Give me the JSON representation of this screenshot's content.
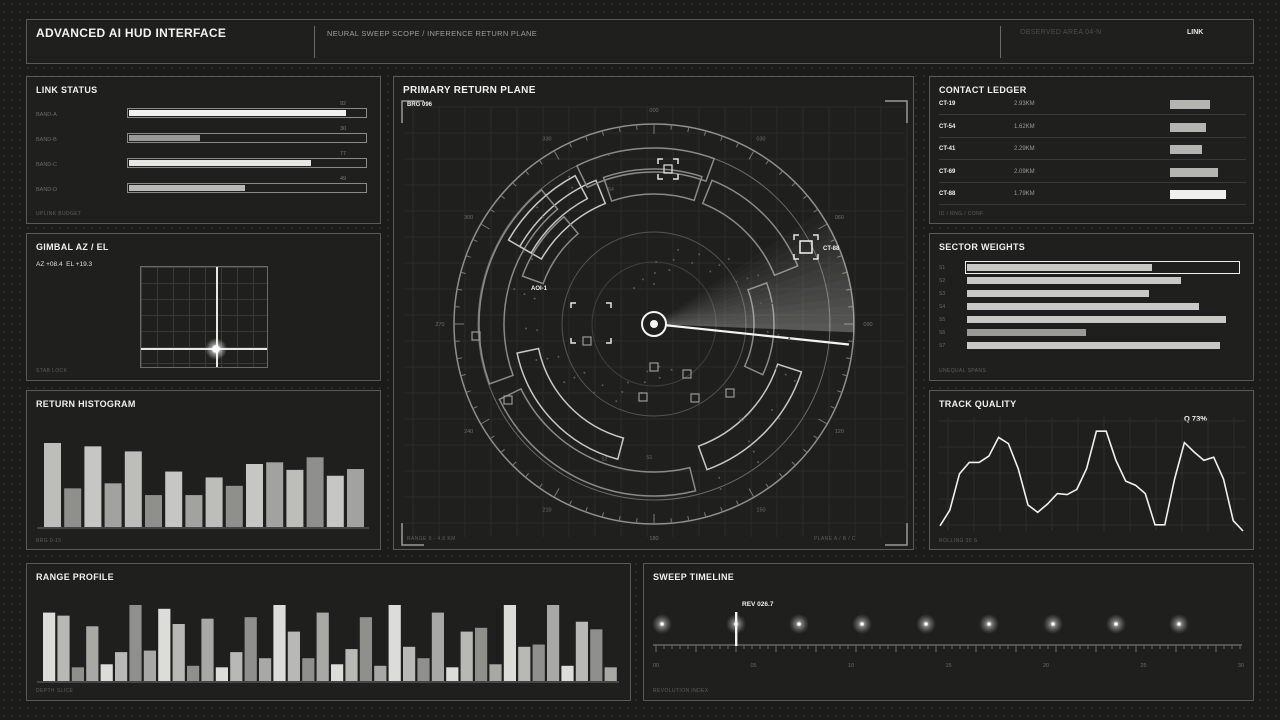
{
  "header": {
    "title": "ADVANCED AI HUD INTERFACE",
    "subtitle": "NEURAL SWEEP SCOPE / INFERENCE RETURN PLANE",
    "area": "OBSERVED AREA 04-N",
    "link": "LINK"
  },
  "link_status": {
    "title": "LINK STATUS",
    "footer": "UPLINK BUDGET",
    "bands": [
      {
        "label": "BAND-A",
        "value": "92",
        "level": 0.92
      },
      {
        "label": "BAND-B",
        "value": "30",
        "level": 0.3
      },
      {
        "label": "BAND-C",
        "value": "77",
        "level": 0.77
      },
      {
        "label": "BAND-D",
        "value": "49",
        "level": 0.49
      }
    ]
  },
  "gimbal": {
    "title": "GIMBAL AZ / EL",
    "readout": "AZ +08.4  EL +19.3",
    "footer": "STAB LOCK"
  },
  "histogram": {
    "title": "RETURN HISTOGRAM",
    "footer": "BRG 0-15"
  },
  "primary": {
    "title": "PRIMARY RETURN PLANE",
    "bearing": "BRG 096",
    "footer_left": "RANGE 0 - 4.8 KM",
    "footer_right": "PLANE A / B / C",
    "bearings": [
      {
        "label": "000"
      },
      {
        "label": "030"
      },
      {
        "label": "060"
      },
      {
        "label": "090"
      },
      {
        "label": "120"
      },
      {
        "label": "150"
      },
      {
        "label": "180"
      },
      {
        "label": "210"
      },
      {
        "label": "240"
      },
      {
        "label": "270"
      },
      {
        "label": "300"
      },
      {
        "label": "330"
      }
    ],
    "sectors": [
      "S4",
      "S2",
      "S1",
      "S7"
    ],
    "contacts": [
      "CT-88",
      "AOI-1"
    ]
  },
  "contacts": {
    "title": "CONTACT LEDGER",
    "footer": "ID / RNG / CONF",
    "rows": [
      {
        "id": "CT-19",
        "range": "2.93KM",
        "conf": 0.72
      },
      {
        "id": "CT-54",
        "range": "1.62KM",
        "conf": 0.65
      },
      {
        "id": "CT-41",
        "range": "2.29KM",
        "conf": 0.58
      },
      {
        "id": "CT-69",
        "range": "2.09KM",
        "conf": 0.86
      },
      {
        "id": "CT-88",
        "range": "1.79KM",
        "conf": 1.0
      }
    ]
  },
  "sectors": {
    "title": "SECTOR WEIGHTS",
    "footer": "UNEQUAL SPANS",
    "rows": [
      {
        "label": "S1",
        "weight": 0.7
      },
      {
        "label": "S2",
        "weight": 0.81
      },
      {
        "label": "S3",
        "weight": 0.69
      },
      {
        "label": "S4",
        "weight": 0.88
      },
      {
        "label": "S5",
        "weight": 0.98
      },
      {
        "label": "S6",
        "weight": 0.45
      },
      {
        "label": "S7",
        "weight": 0.96
      }
    ]
  },
  "track": {
    "title": "TRACK QUALITY",
    "quality": "Q 73%",
    "footer": "ROLLING 30 S"
  },
  "range_profile": {
    "title": "RANGE PROFILE",
    "footer": "DEPTH SLICE"
  },
  "sweep": {
    "title": "SWEEP TIMELINE",
    "marker": "REV 026.7",
    "footer": "REVOLUTION INDEX",
    "ticks": [
      "00",
      "05",
      "10",
      "15",
      "20",
      "25",
      "30"
    ]
  },
  "chart_data": [
    {
      "type": "bar",
      "title": "RETURN HISTOGRAM",
      "values": [
        100,
        46,
        96,
        52,
        90,
        38,
        66,
        38,
        59,
        49,
        75,
        77,
        68,
        83,
        61,
        69
      ],
      "ylim": [
        0,
        100
      ]
    },
    {
      "type": "line",
      "title": "TRACK QUALITY",
      "values": [
        5,
        20,
        55,
        66,
        66,
        72,
        90,
        84,
        60,
        25,
        18,
        26,
        36,
        35,
        40,
        60,
        96,
        96,
        68,
        48,
        44,
        36,
        6,
        6,
        50,
        85,
        76,
        68,
        71,
        50,
        10,
        0
      ],
      "ylim": [
        0,
        100
      ]
    },
    {
      "type": "bar",
      "title": "RANGE PROFILE",
      "values": [
        90,
        86,
        18,
        72,
        22,
        38,
        100,
        40,
        95,
        75,
        20,
        82,
        18,
        38,
        84,
        30,
        100,
        65,
        30,
        90,
        22,
        42,
        84,
        20,
        100,
        45,
        30,
        90,
        18,
        65,
        70,
        22,
        100,
        45,
        48,
        100,
        20,
        78,
        68,
        18
      ],
      "ylim": [
        0,
        100
      ]
    }
  ]
}
